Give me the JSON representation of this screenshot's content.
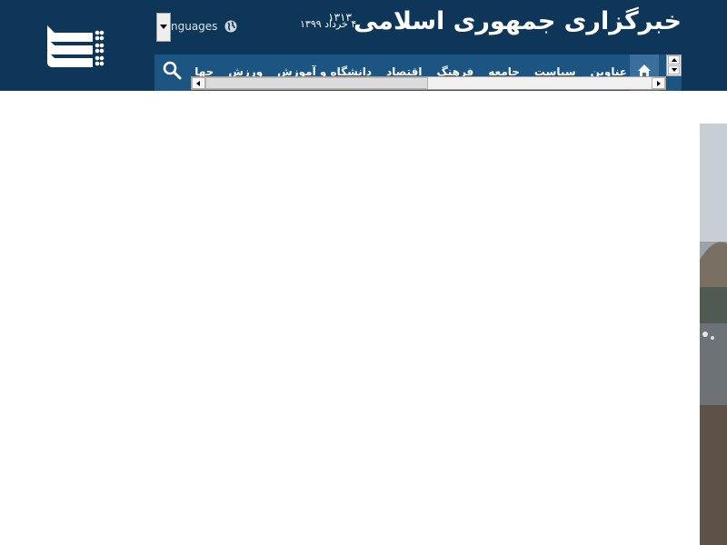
{
  "header": {
    "site_title": "خبرگزاری جمهوری اسلامی",
    "title_year": "۱۳۱۳",
    "date": "۴ خرداد ۱۳۹۹",
    "languages_label": "nguages",
    "brand_color": "#0e3658",
    "nav_color": "#1c5482"
  },
  "nav": {
    "items": [
      {
        "label": "عناوین"
      },
      {
        "label": "سیاست"
      },
      {
        "label": "جامعه"
      },
      {
        "label": "فرهنگ"
      },
      {
        "label": "اقتصاد"
      },
      {
        "label": "دانشگاه و آموزش"
      },
      {
        "label": "ورزش"
      },
      {
        "label": "جها"
      }
    ],
    "icons": {
      "home": "home-icon",
      "search": "search-icon"
    }
  }
}
